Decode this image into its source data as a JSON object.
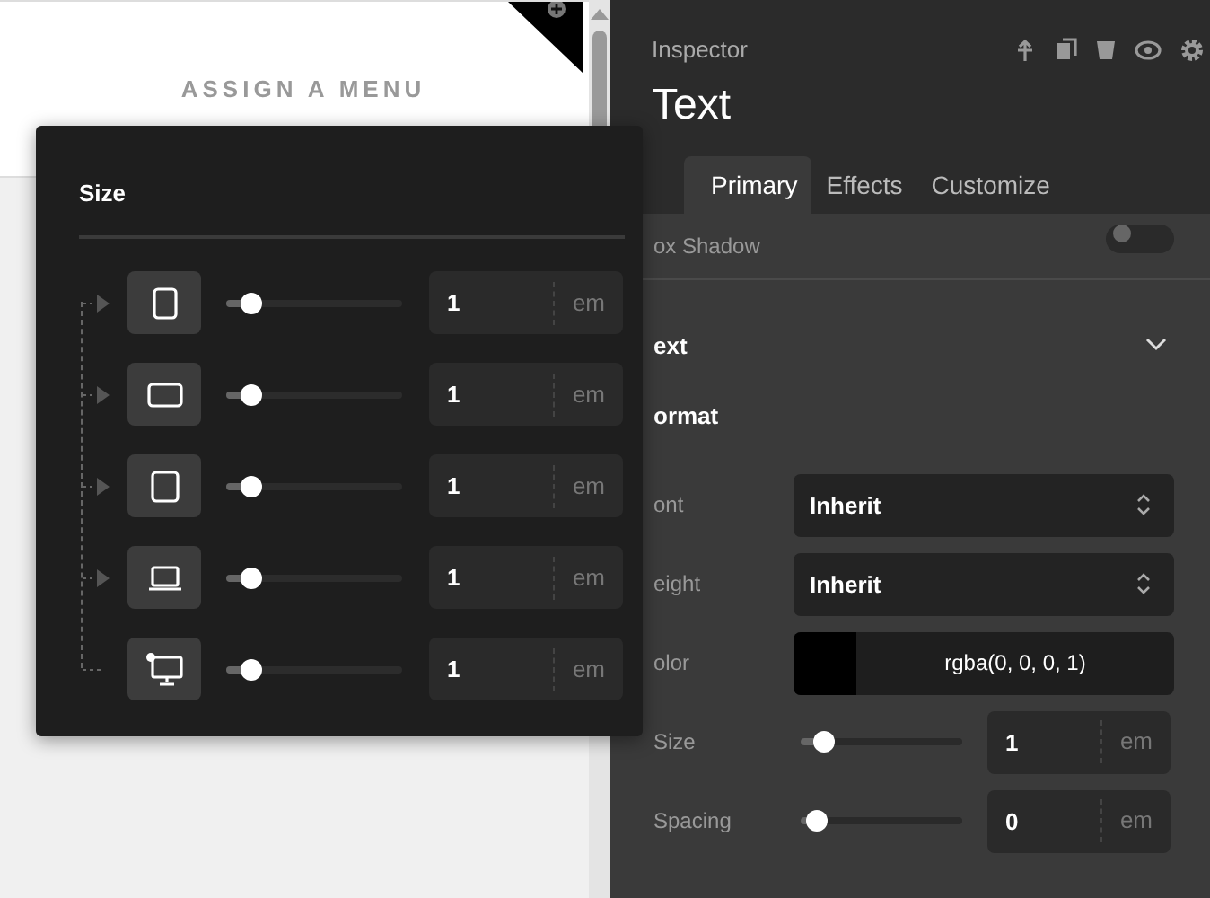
{
  "canvas": {
    "menu_label": "ASSIGN A MENU"
  },
  "size_popup": {
    "title": "Size",
    "rows": [
      {
        "kind": "phone",
        "level": 0.14,
        "value": "1",
        "unit": "em"
      },
      {
        "kind": "tablet-landscape",
        "level": 0.14,
        "value": "1",
        "unit": "em"
      },
      {
        "kind": "tablet",
        "level": 0.14,
        "value": "1",
        "unit": "em"
      },
      {
        "kind": "laptop",
        "level": 0.14,
        "value": "1",
        "unit": "em"
      },
      {
        "kind": "desktop",
        "level": 0.14,
        "value": "1",
        "unit": "em"
      }
    ]
  },
  "inspector": {
    "title": "Inspector",
    "heading": "Text",
    "tabs": [
      {
        "label": "Primary",
        "selected": true
      },
      {
        "label": "Effects",
        "selected": false
      },
      {
        "label": "Customize",
        "selected": false
      }
    ],
    "box_shadow": {
      "label": "ox Shadow",
      "on": false
    },
    "section": {
      "title": "ext",
      "expanded": true
    },
    "group_title": "ormat",
    "fields": [
      {
        "kind": "select",
        "label": "ont",
        "value": "Inherit"
      },
      {
        "kind": "select",
        "label": "eight",
        "value": "Inherit"
      },
      {
        "kind": "color",
        "label": "olor",
        "value": "rgba(0, 0, 0, 1)"
      },
      {
        "kind": "slider",
        "label": "Size",
        "level": 0.14,
        "value": "1",
        "unit": "em"
      },
      {
        "kind": "slider",
        "label": "Spacing",
        "level": 0.1,
        "value": "0",
        "unit": "em"
      }
    ]
  }
}
